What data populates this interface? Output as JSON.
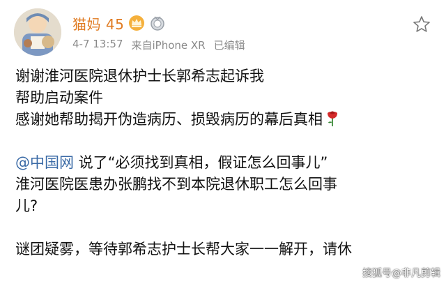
{
  "header": {
    "username": "猫妈 45",
    "timestamp": "4-7 13:57",
    "source": "来自iPhone XR",
    "edited": "已编辑"
  },
  "body": {
    "line1": "谢谢淮河医院退休护士长郭希志起诉我",
    "line2": "帮助启动案件",
    "line3": "感谢她帮助揭开伪造病历、损毁病历的幕后真相",
    "mention": "@中国网",
    "line4_rest": " 说了“必须找到真相，假证怎么回事儿”",
    "line5": "淮河医院医患办张鹏找不到本院退休职工怎么回事",
    "line6": "儿?",
    "line7": "谜团疑雾，等待郭希志护士长帮大家一一解开，请休"
  },
  "watermark": "搜狐号@非凡剪辑",
  "icons": {
    "avatar": "avatar-illustration",
    "vip_badge": "crown-badge-icon",
    "level_badge": "medal-badge-icon",
    "star": "star-outline-icon",
    "rose": "rose-emoji-icon"
  },
  "colors": {
    "username": "#e07b22",
    "mention": "#3a6aa6",
    "meta": "#8a8a8a"
  }
}
